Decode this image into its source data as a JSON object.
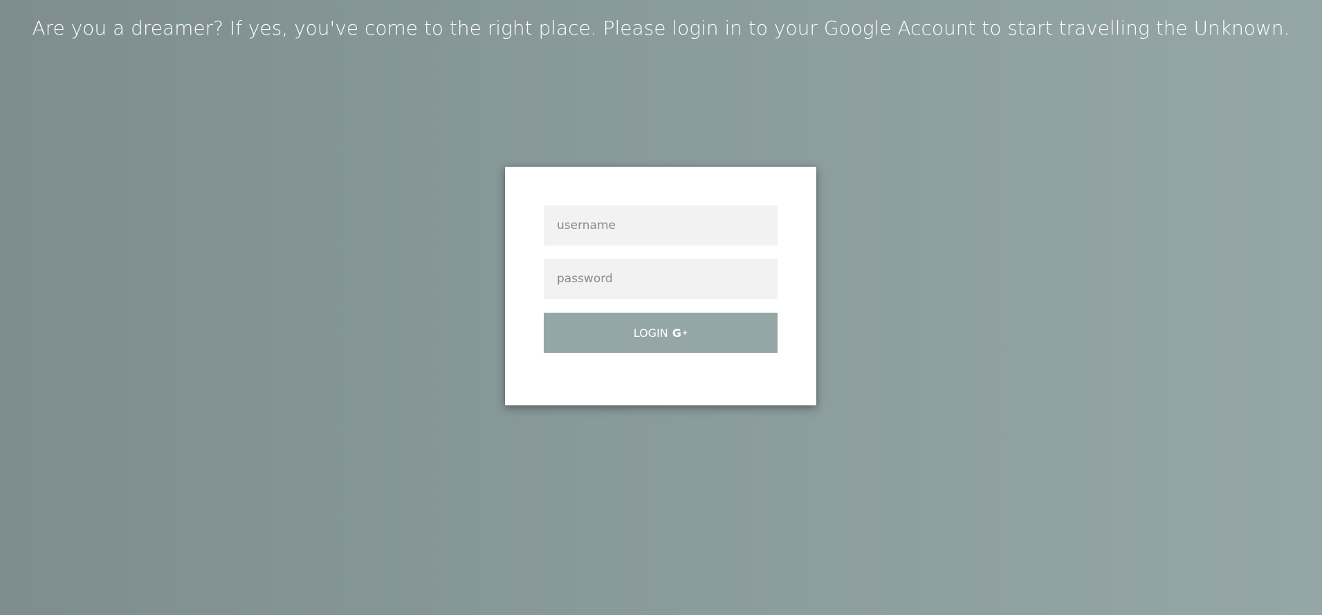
{
  "header": {
    "message": "Are you a dreamer? If yes, you've come to the right place. Please login in to your Google Account to start travelling the Unknown."
  },
  "login_form": {
    "username_placeholder": "username",
    "password_placeholder": "password",
    "login_label": "LOGIN",
    "login_icon": "google-plus-icon"
  },
  "colors": {
    "background": "#8a9b9b",
    "card": "#ffffff",
    "field": "#f2f2f2",
    "button": "#95a6a6"
  }
}
